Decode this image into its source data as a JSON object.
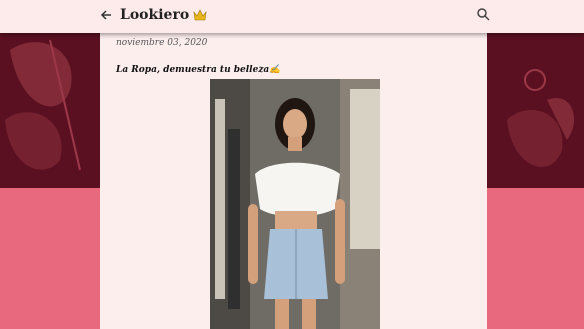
{
  "header": {
    "title": "Lookiero",
    "crown_icon": "crown-icon",
    "back_icon": "arrow-left-icon",
    "search_icon": "search-icon"
  },
  "post": {
    "date": "noviembre 03, 2020",
    "title": "La Ropa, demuestra tu belleza"
  },
  "colors": {
    "header_bg": "#fdeaea",
    "bg_dark": "#5a1020",
    "bg_pink": "#e8697d",
    "post_bg": "#fdeeee"
  }
}
